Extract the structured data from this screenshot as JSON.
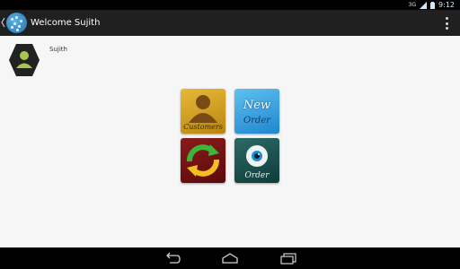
{
  "status_bar": {
    "network": "3G",
    "time": "9:12"
  },
  "action_bar": {
    "title": "Welcome Sujith"
  },
  "profile": {
    "name": "Sujith"
  },
  "tiles": [
    {
      "label": "Customers",
      "icon": "customer-person-icon"
    },
    {
      "label_line1": "New",
      "label_line2": "Order",
      "icon": "new-order-icon"
    },
    {
      "label": "",
      "icon": "sync-arrows-icon"
    },
    {
      "label": "Order",
      "icon": "eye-icon"
    }
  ],
  "colors": {
    "status_bar": "#000000",
    "action_bar": "#202020",
    "background": "#f6f6f6",
    "customers_tile": "#d9a52a",
    "new_order_tile": "#3ba5e2",
    "sync_tile": "#7a1414",
    "order_tile": "#225855"
  }
}
